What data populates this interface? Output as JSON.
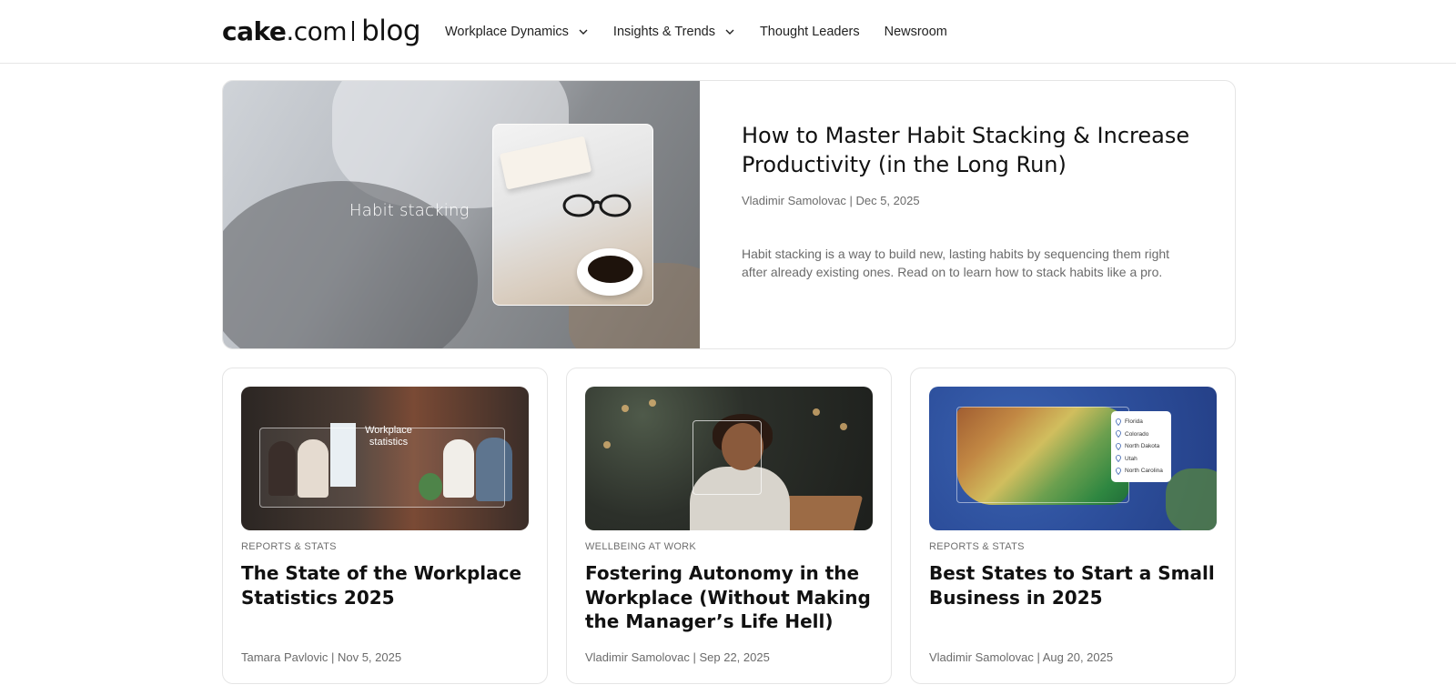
{
  "header": {
    "logo": {
      "brand_bold": "cake",
      "brand_light": ".com",
      "section": "blog"
    },
    "nav": [
      {
        "label": "Workplace Dynamics",
        "has_dropdown": true
      },
      {
        "label": "Insights & Trends",
        "has_dropdown": true
      },
      {
        "label": "Thought Leaders",
        "has_dropdown": false
      },
      {
        "label": "Newsroom",
        "has_dropdown": false
      }
    ]
  },
  "hero": {
    "image_label": "Habit stacking",
    "title": "How to Master Habit Stacking & Increase Productivity (in the Long Run)",
    "meta": "Vladimir Samolovac | Dec 5, 2025",
    "description": "Habit stacking is a way to build new, lasting habits by sequencing them right after already existing ones. Read on to learn how to stack habits like a pro."
  },
  "cards": [
    {
      "category": "REPORTS & STATS",
      "title": "The State of the Workplace Statistics 2025",
      "meta": "Tamara Pavlovic | Nov 5, 2025",
      "image_label": "Workplace statistics"
    },
    {
      "category": "WELLBEING AT WORK",
      "title": "Fostering Autonomy in the Workplace (Without Making the Manager’s Life Hell)",
      "meta": "Vladimir Samolovac | Sep 22, 2025"
    },
    {
      "category": "REPORTS & STATS",
      "title": "Best States to Start a Small Business in 2025",
      "meta": "Vladimir Samolovac | Aug 20, 2025",
      "image_legend": [
        "Florida",
        "Colorado",
        "North Dakota",
        "Utah",
        "North Carolina"
      ]
    }
  ],
  "icons": {
    "dropdown": "chevron-down-icon",
    "map_pin": "map-pin-icon"
  }
}
